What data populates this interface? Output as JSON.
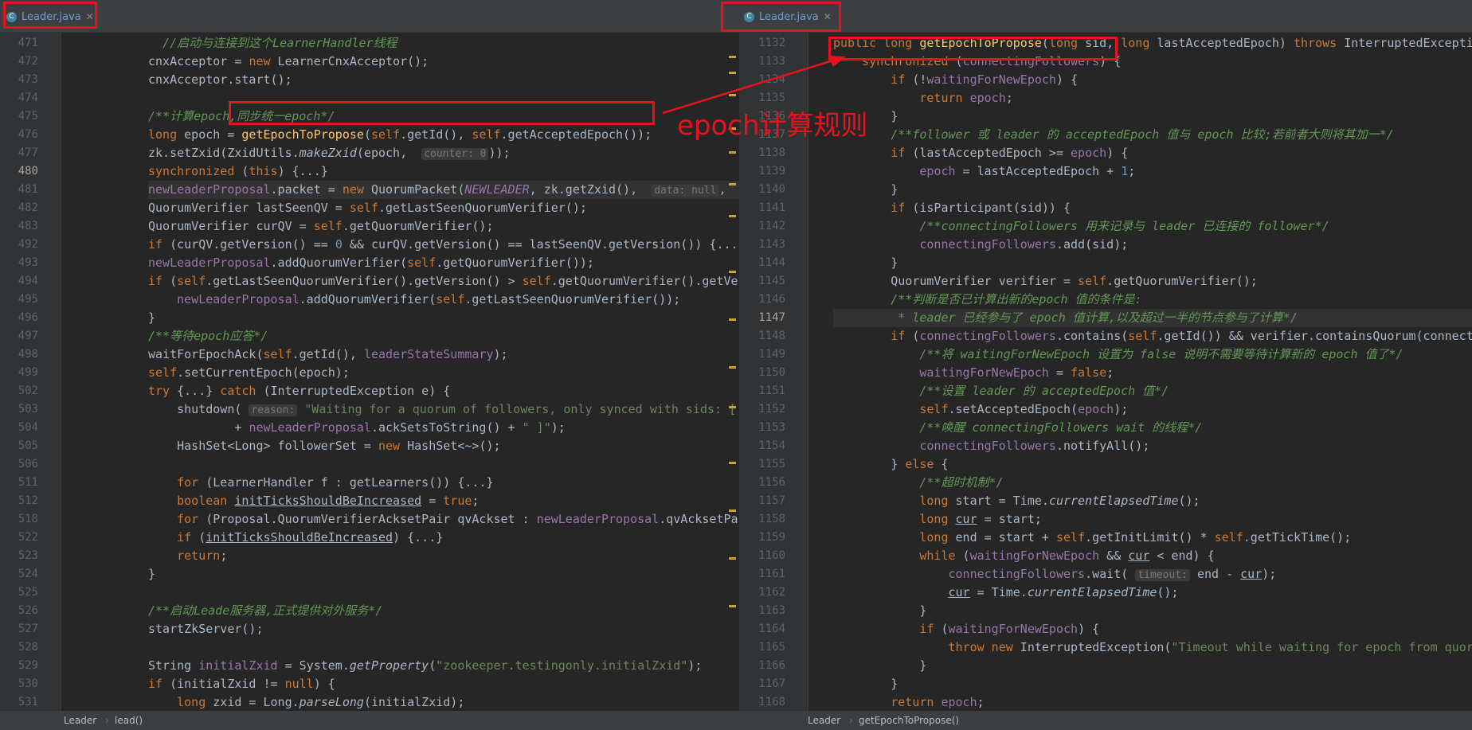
{
  "left": {
    "tab_label": "Leader.java",
    "breadcrumb": [
      "Leader",
      "lead()"
    ],
    "line_numbers": [
      "471",
      "472",
      "473",
      "474",
      "475",
      "476",
      "477",
      "480",
      "481",
      "482",
      "483",
      "492",
      "493",
      "494",
      "495",
      "496",
      "497",
      "498",
      "499",
      "502",
      "503",
      "504",
      "505",
      "506",
      "511",
      "512",
      "518",
      "522",
      "523",
      "524",
      "525",
      "526",
      "527",
      "528",
      "529",
      "530",
      "531"
    ],
    "current_line": "480"
  },
  "right": {
    "tab_label": "Leader.java",
    "breadcrumb": [
      "Leader",
      "getEpochToPropose()"
    ],
    "line_numbers": [
      "1132",
      "1133",
      "1134",
      "1135",
      "1136",
      "1137",
      "1138",
      "1139",
      "1140",
      "1141",
      "1142",
      "1143",
      "1144",
      "1145",
      "1146",
      "1147",
      "1148",
      "1149",
      "1150",
      "1151",
      "1152",
      "1153",
      "1154",
      "1155",
      "1156",
      "1157",
      "1158",
      "1159",
      "1160",
      "1161",
      "1162",
      "1163",
      "1164",
      "1165",
      "1166",
      "1167",
      "1168"
    ],
    "current_line": "1147"
  },
  "annotation": {
    "text": "epoch计算规则"
  },
  "colors": {
    "highlight_red": "#e8121e",
    "keyword": "#cc7832",
    "comment": "#629755",
    "string": "#6a8759"
  },
  "icons": {
    "tab_icon": "java-class-icon",
    "close": "close-icon"
  }
}
